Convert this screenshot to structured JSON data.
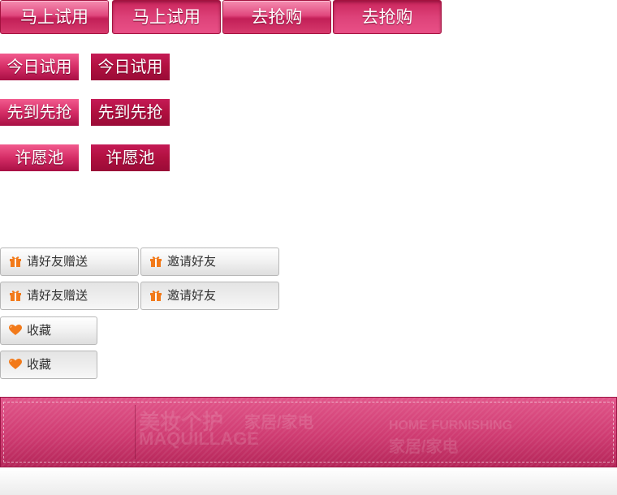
{
  "big_buttons": [
    {
      "label": "马上试用",
      "state": "normal"
    },
    {
      "label": "马上试用",
      "state": "pressed"
    },
    {
      "label": "去抢购",
      "state": "normal"
    },
    {
      "label": "去抢购",
      "state": "pressed"
    }
  ],
  "small_buttons": [
    {
      "label": "今日试用"
    },
    {
      "label": "今日试用"
    },
    {
      "label": "先到先抢"
    },
    {
      "label": "先到先抢"
    },
    {
      "label": "许愿池"
    },
    {
      "label": "许愿池"
    }
  ],
  "grey_buttons": [
    {
      "label": "请好友赠送",
      "icon": "gift-icon"
    },
    {
      "label": "邀请好友",
      "icon": "gift-icon"
    },
    {
      "label": "请好友赠送",
      "icon": "gift-icon"
    },
    {
      "label": "邀请好友",
      "icon": "gift-icon"
    },
    {
      "label": "收藏",
      "icon": "heart-icon"
    },
    {
      "label": "收藏",
      "icon": "heart-icon"
    }
  ],
  "banner": {
    "watermark_1": "美妆个护",
    "watermark_2": "家居/家电",
    "watermark_3": "MAQUILLAGE",
    "watermark_4": "HOME FURNISHING",
    "watermark_5": "家居/家电"
  },
  "colors": {
    "accent": "#d52d66",
    "icon_orange": "#f27a1a",
    "border_grey": "#b7b7b7"
  }
}
